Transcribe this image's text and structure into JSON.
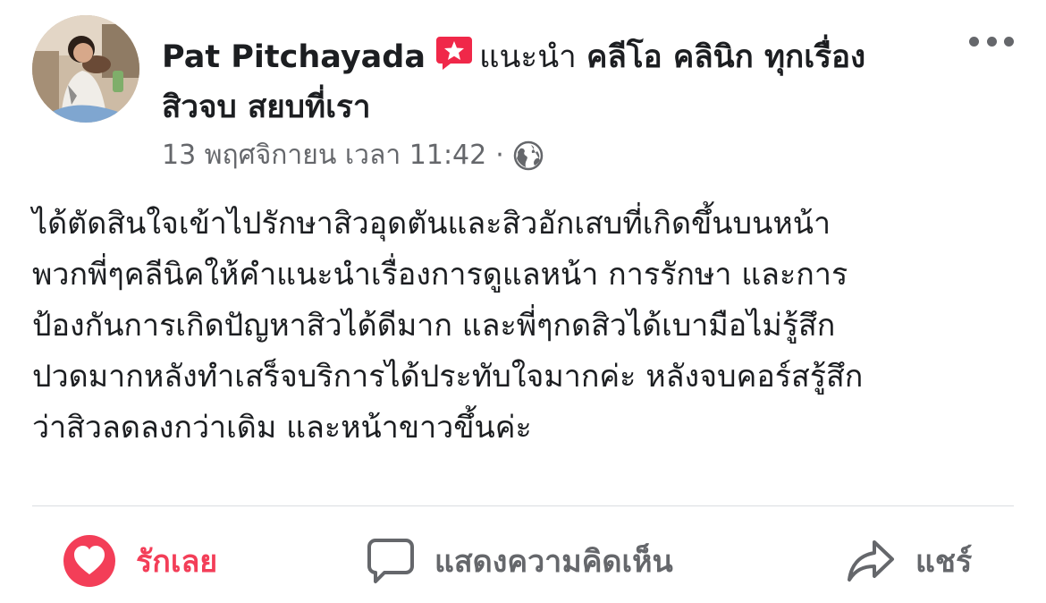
{
  "post": {
    "author": "Pat Pitchayada",
    "recommend_label": "แนะนำ",
    "page_name_line1": "คลีโอ คลินิก ทุกเรื่อง",
    "page_name_line2": "สิวจบ สยบที่เรา",
    "timestamp": "13 พฤศจิกายน เวลา 11:42",
    "separator": "·",
    "privacy_icon": "globe-icon",
    "badge_icon": "recommendation-star-icon",
    "body": "ได้ตัดสินใจเข้าไปรักษาสิวอุดตันและสิวอักเสบที่เกิดขึ้นบนหน้า\nพวกพี่ๆคลีนิคให้คำแนะนำเรื่องการดูแลหน้า การรักษา และการ\nป้องกันการเกิดปัญหาสิวได้ดีมาก และพี่ๆกดสิวได้เบามือไม่รู้สึก\nปวดมากหลังทำเสร็จบริการได้ประทับใจมากค่ะ หลังจบคอร์สรู้สึก\nว่าสิวลดลงกว่าเดิม และหน้าขาวขึ้นค่ะ"
  },
  "actions": {
    "like_label": "รักเลย",
    "comment_label": "แสดงความคิดเห็น",
    "share_label": "แชร์"
  },
  "colors": {
    "love": "#f33e58",
    "badge": "#f02849",
    "secondary_text": "#65676b",
    "divider": "#dadde1"
  }
}
